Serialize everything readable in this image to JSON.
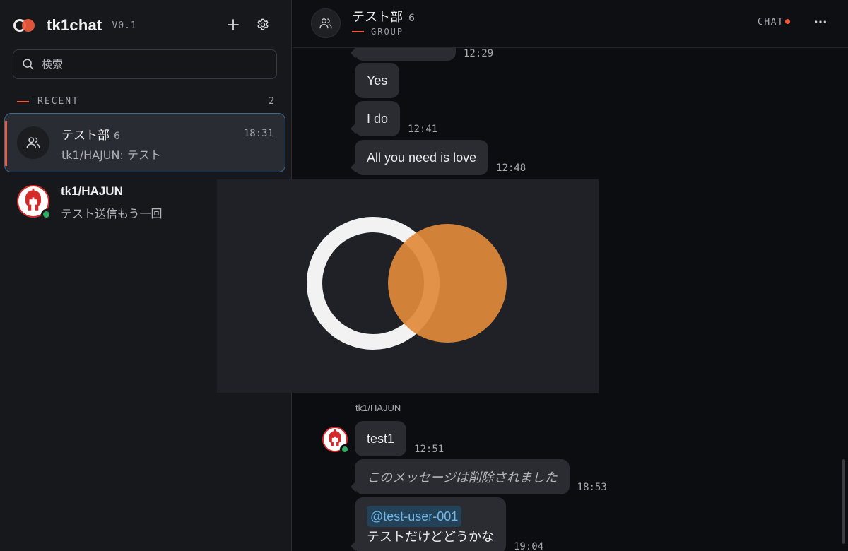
{
  "brand": {
    "name": "tk1chat",
    "version": "V0.1"
  },
  "sidebar": {
    "search_placeholder": "検索",
    "section_label": "RECENT",
    "section_count": "2",
    "conversations": [
      {
        "name": "テスト部",
        "member_count": "6",
        "time": "18:31",
        "preview": "tk1/HAJUN: テスト",
        "avatar_icon": "users-icon",
        "active": true
      },
      {
        "name": "tk1/HAJUN",
        "preview": "テスト送信もう一回",
        "avatar_icon": "spartan-helmet-avatar",
        "status": "online"
      }
    ]
  },
  "chat": {
    "title": "テスト部",
    "member_count": "6",
    "subtitle": "GROUP",
    "mode_label": "CHAT",
    "messages_top": [
      {
        "text": "",
        "time": "12:29"
      },
      {
        "text": "Yes",
        "time": ""
      },
      {
        "text": "I do",
        "time": "12:41"
      },
      {
        "text": "All you need is love",
        "time": "12:48"
      }
    ],
    "sender_name": "tk1/HAJUN",
    "messages_bottom": [
      {
        "text": "test1",
        "time": "12:51"
      },
      {
        "text": "このメッセージは削除されました",
        "time": "18:53",
        "deleted": true
      },
      {
        "mention": "@test-user-001",
        "text": "テストだけどどうかな",
        "time": "19:04"
      }
    ]
  },
  "colors": {
    "accent": "#ef5a3c",
    "selection_border": "#3d6a92",
    "online": "#2fae63",
    "logo_orange": "#e28a3b"
  }
}
